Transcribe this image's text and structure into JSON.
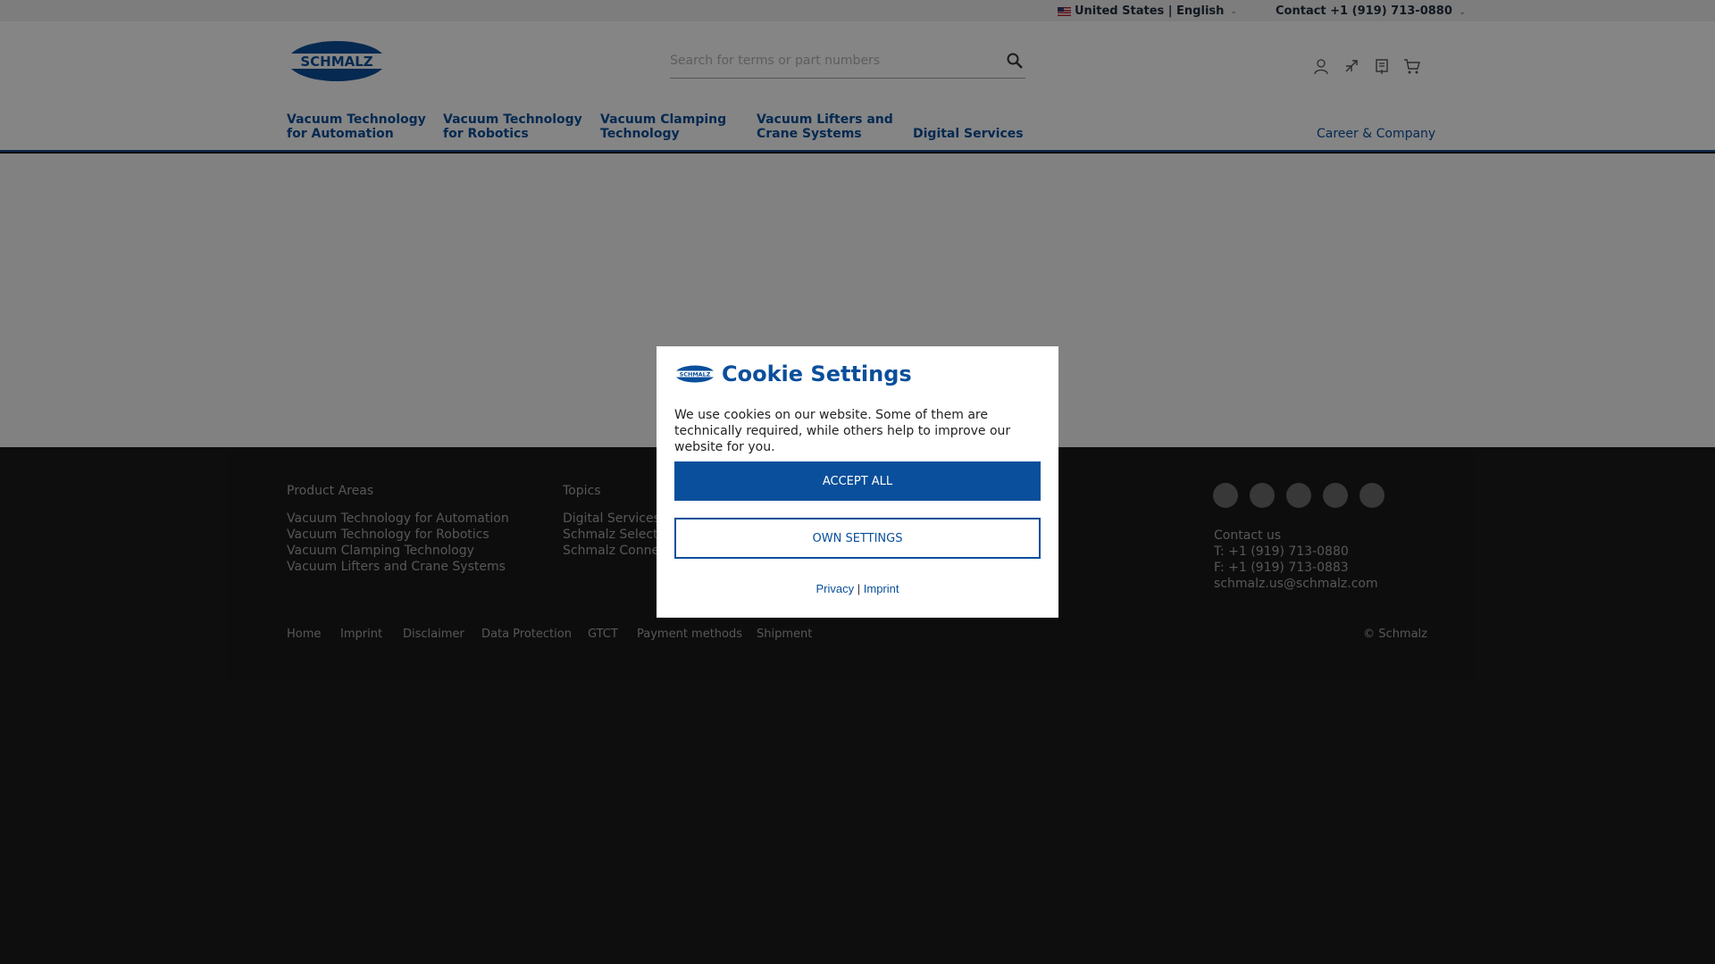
{
  "topbar": {
    "language": "United States | English",
    "contact": "Contact +1 (919) 713-0880"
  },
  "header": {
    "logo_text": "SCHMALZ",
    "search_placeholder": "Search for terms or part numbers",
    "icons": [
      "user-icon",
      "compare-icon",
      "notepad-icon",
      "cart-icon"
    ]
  },
  "nav": {
    "items": [
      {
        "line1": "Vacuum Technology",
        "line2": "for Automation"
      },
      {
        "line1": "Vacuum Technology",
        "line2": "for Robotics"
      },
      {
        "line1": "Vacuum Clamping",
        "line2": "Technology"
      },
      {
        "line1": "Vacuum Lifters and",
        "line2": "Crane Systems"
      },
      {
        "line1": "",
        "line2": "Digital Services"
      }
    ],
    "career": "Career & Company"
  },
  "footer": {
    "product_areas": {
      "heading": "Product Areas",
      "links": [
        "Vacuum Technology for Automation",
        "Vacuum Technology for Robotics",
        "Vacuum Clamping Technology",
        "Vacuum Lifters and Crane Systems"
      ]
    },
    "topics": {
      "heading": "Topics",
      "links": [
        "Digital Services",
        "Schmalz Select",
        "Schmalz Connect"
      ]
    },
    "social": [
      "youtube-icon",
      "linkedin-icon",
      "facebook-icon",
      "twitter-icon",
      "instagram-icon"
    ],
    "contact": {
      "heading": "Contact us",
      "phone": "T: +1 (919) 713-0880",
      "fax": "F: +1 (919) 713-0883",
      "email": "schmalz.us@schmalz.com"
    },
    "bottom_links": [
      "Home",
      "Imprint",
      "Disclaimer",
      "Data Protection",
      "GTCT",
      "Payment methods",
      "Shipment"
    ],
    "copyright": "© Schmalz"
  },
  "cookie_modal": {
    "logo_text": "SCHMALZ",
    "title": "Cookie Settings",
    "text": "We use cookies on our website. Some of them are technically required, while others help to improve our website for you.",
    "accept_all": "ACCEPT ALL",
    "own_settings": "OWN SETTINGS",
    "privacy": "Privacy",
    "separator": "|",
    "imprint": "Imprint"
  },
  "colors": {
    "brand_blue": "#0a4f9b",
    "footer_bg": "#1a1a1a",
    "overlay": "rgba(0,0,0,0.48)"
  }
}
